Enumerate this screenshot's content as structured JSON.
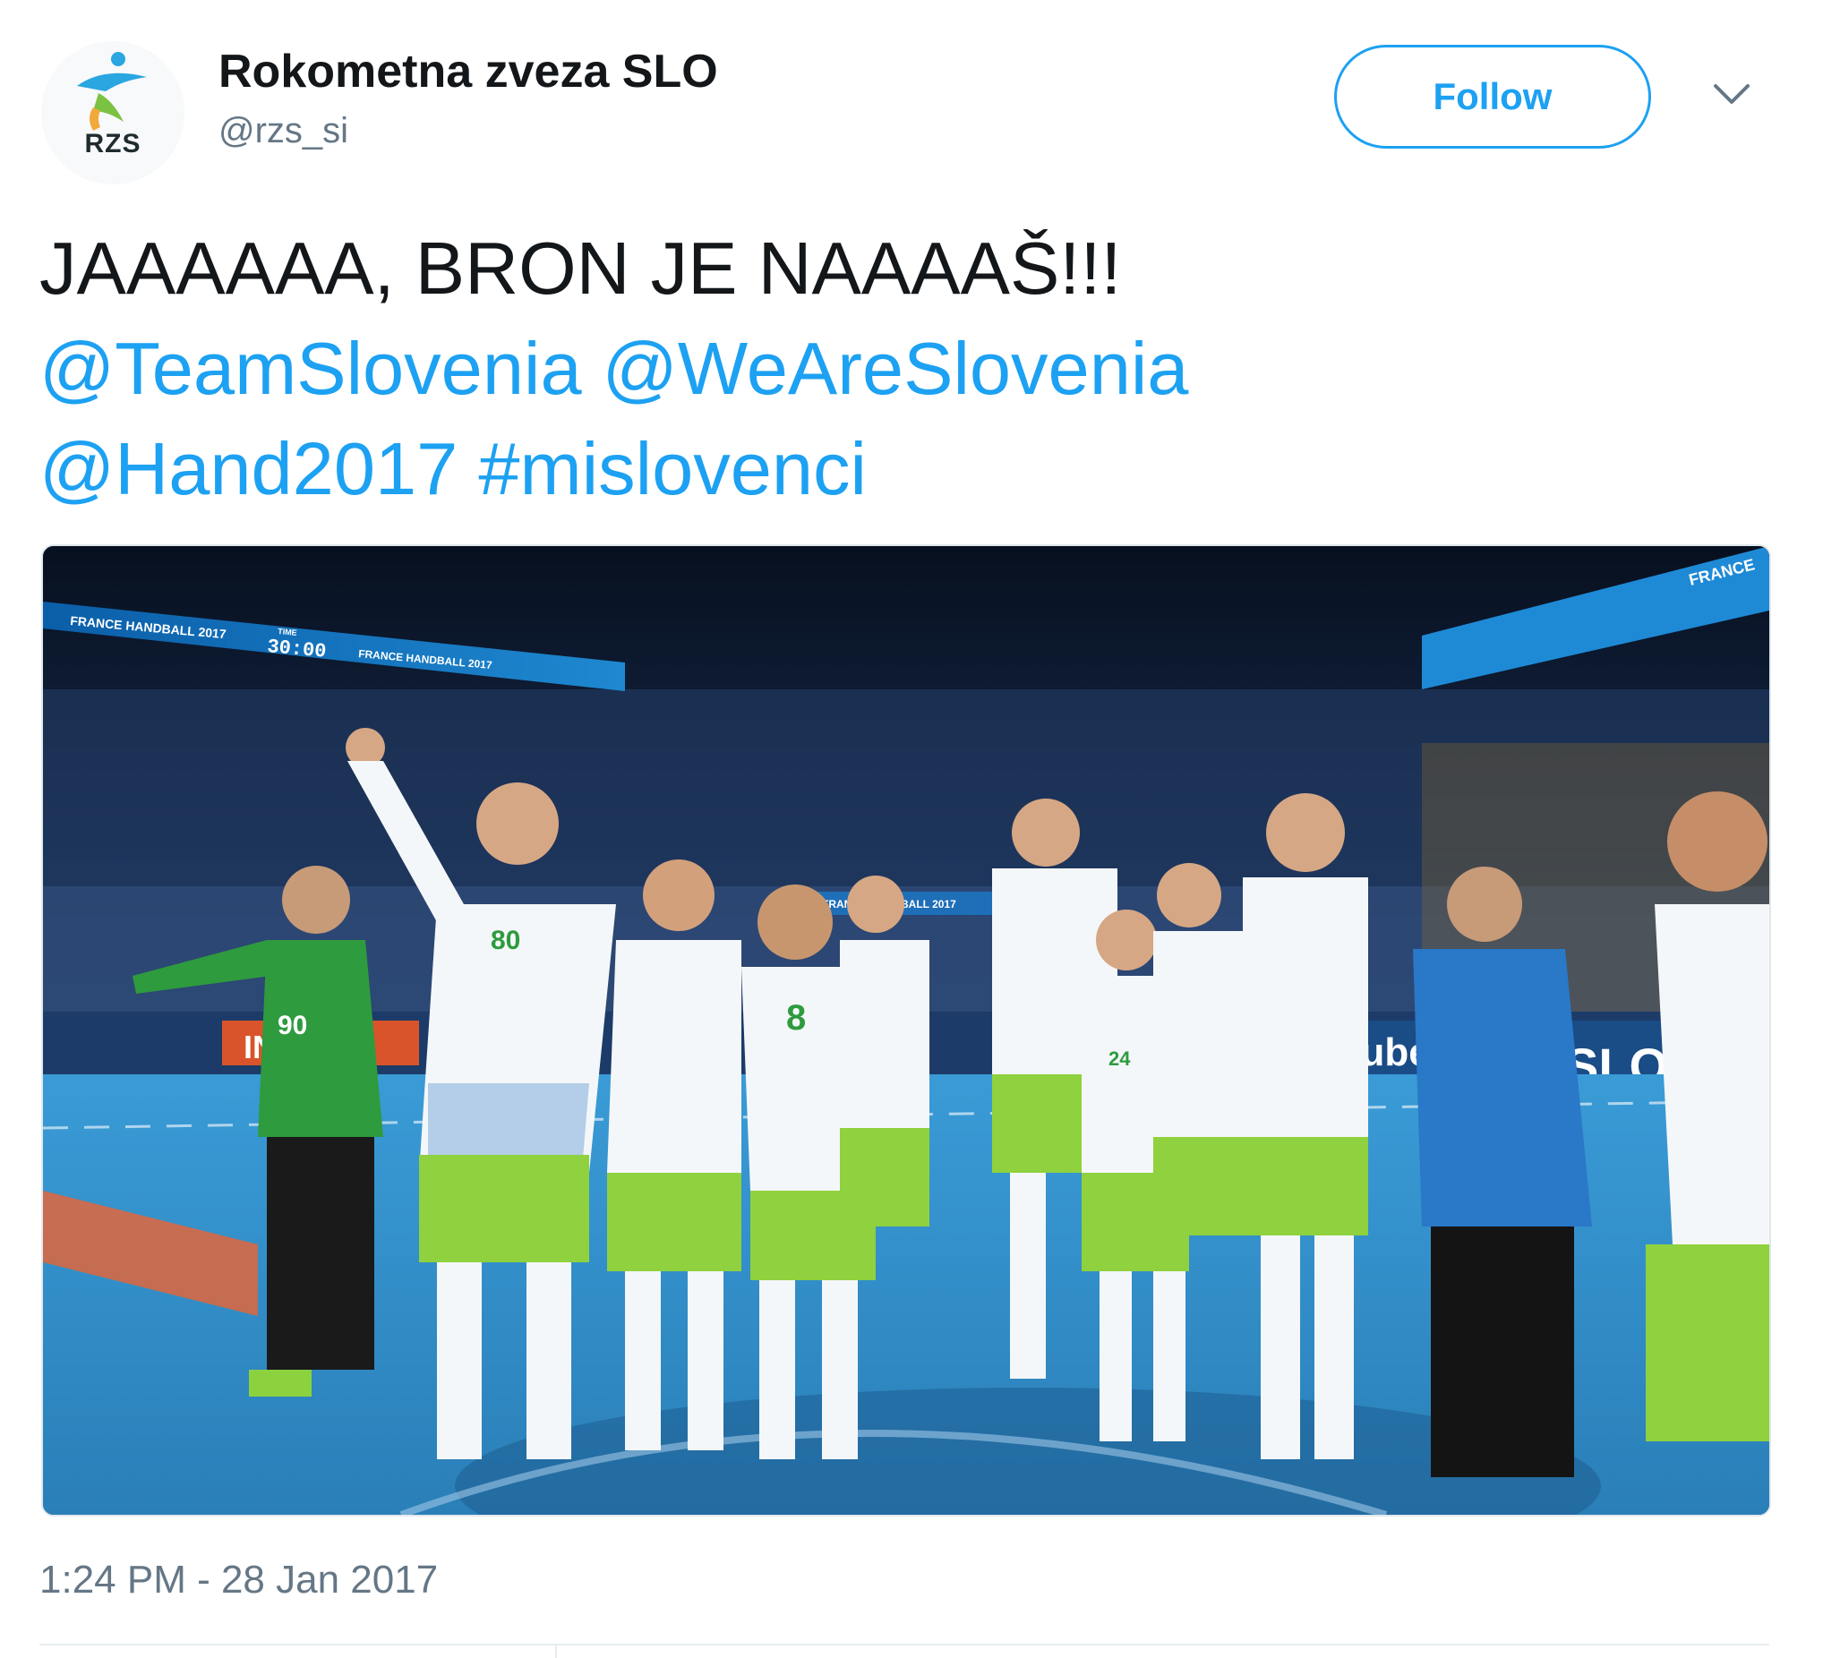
{
  "user": {
    "avatar_text": "RZS",
    "name": "Rokometna zveza SLO",
    "handle": "@rzs_si",
    "follow_label": "Follow"
  },
  "tweet": {
    "line1": "JAAAAAA, BRON JE NAAAAŠ!!!",
    "mention_team": "@TeamSlovenia",
    "mention_weare": "@WeAreSlovenia",
    "mention_hand": "@Hand2017",
    "hashtag": "#mislovenci",
    "timestamp": "1:24 PM - 28 Jan 2017"
  },
  "media": {
    "scoreboard_left": "FRANCE HANDBALL 2017",
    "scoreboard_time_label": "TIME",
    "scoreboard_time": "30:00",
    "scoreboard_right": "FRANCE HANDBALL 2017",
    "banner_right": "FRANCE",
    "banner_mid": "FRANCE HANDBALL 2017",
    "ad_left": "IN",
    "ad_youtube": "utube",
    "ad_slo": "SLO",
    "jersey_goalkeeper": "90",
    "jersey_main": "80",
    "jersey_center": "8",
    "jersey_small": "24"
  },
  "icons": {
    "chevron": "chevron-down-icon",
    "logo": "rzs-handball-logo"
  },
  "colors": {
    "accent": "#1da1f2",
    "text": "#14171a",
    "secondary": "#657786",
    "jersey_green": "#8fd13f",
    "court_blue": "#3a9bd6"
  }
}
